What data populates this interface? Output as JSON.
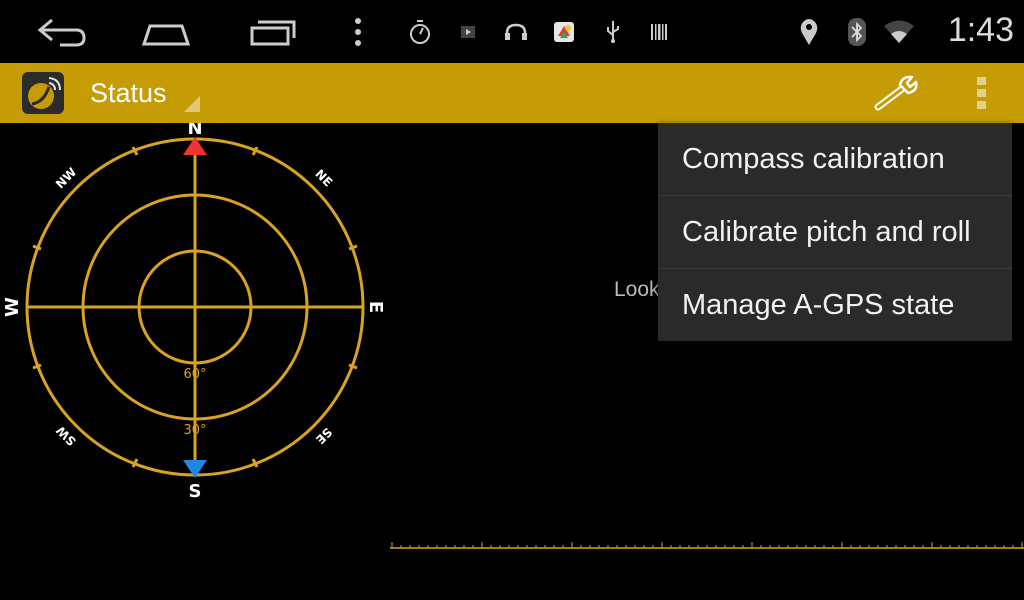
{
  "statusbar": {
    "time": "1:43"
  },
  "appbar": {
    "spinner_label": "Status"
  },
  "radar": {
    "cardinal": {
      "n": "N",
      "s": "S",
      "e": "E",
      "w": "W"
    },
    "intercardinal": {
      "nw": "NW",
      "ne": "NE",
      "sw": "SW",
      "se": "SE"
    },
    "elevation_labels": {
      "inner": "60°",
      "middle": "30°"
    },
    "colors": {
      "ring": "#d9a322",
      "north_marker": "#ee3333",
      "south_marker": "#1e88e5"
    }
  },
  "main": {
    "looking_text": "Look"
  },
  "menu": {
    "items": [
      {
        "label": "Compass calibration"
      },
      {
        "label": "Calibrate pitch and roll"
      },
      {
        "label": "Manage A-GPS state"
      }
    ]
  },
  "theme": {
    "appbar_color": "#c69c06",
    "accent": "#d9a322"
  }
}
